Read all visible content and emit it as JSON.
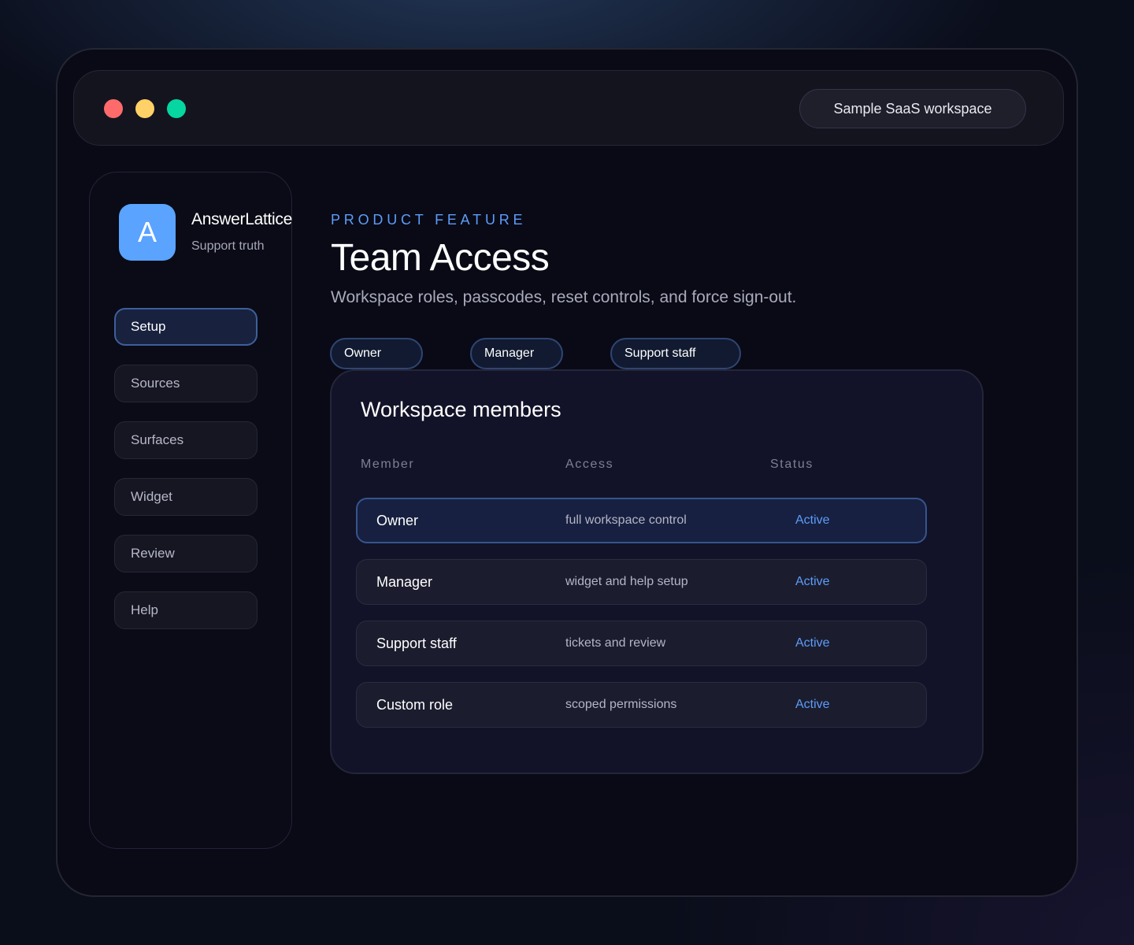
{
  "titlebar": {
    "workspace_label": "Sample SaaS workspace"
  },
  "sidebar": {
    "logo_letter": "A",
    "brand_name": "AnswerLattice",
    "brand_subtitle": "Support truth",
    "items": [
      {
        "label": "Setup",
        "active": true
      },
      {
        "label": "Sources",
        "active": false
      },
      {
        "label": "Surfaces",
        "active": false
      },
      {
        "label": "Widget",
        "active": false
      },
      {
        "label": "Review",
        "active": false
      },
      {
        "label": "Help",
        "active": false
      }
    ]
  },
  "header": {
    "eyebrow": "PRODUCT FEATURE",
    "title": "Team Access",
    "description": "Workspace roles, passcodes, reset controls, and force sign-out."
  },
  "role_chips": [
    "Owner",
    "Manager",
    "Support staff"
  ],
  "members_panel": {
    "title": "Workspace members",
    "columns": [
      "Member",
      "Access",
      "Status"
    ],
    "rows": [
      {
        "member": "Owner",
        "access": "full workspace control",
        "status": "Active",
        "highlighted": true
      },
      {
        "member": "Manager",
        "access": "widget and help setup",
        "status": "Active",
        "highlighted": false
      },
      {
        "member": "Support staff",
        "access": "tickets and review",
        "status": "Active",
        "highlighted": false
      },
      {
        "member": "Custom role",
        "access": "scoped permissions",
        "status": "Active",
        "highlighted": false
      }
    ]
  },
  "colors": {
    "accent": "#5d9cfa",
    "logo_bg": "#5aa3ff",
    "traffic_red": "#ff6b6b",
    "traffic_yellow": "#ffd166",
    "traffic_green": "#06d6a0"
  }
}
